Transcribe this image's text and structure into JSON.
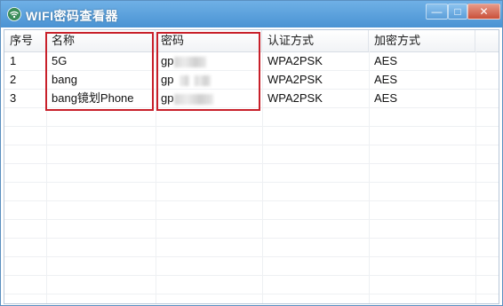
{
  "window": {
    "title": "WIFI密码查看器",
    "buttons": {
      "minimize": "—",
      "maximize": "□",
      "close": "✕"
    }
  },
  "table": {
    "columns": [
      "序号",
      "名称",
      "密码",
      "认证方式",
      "加密方式"
    ],
    "rows": [
      {
        "index": "1",
        "name": "5G",
        "password_visible": "gp",
        "auth": "WPA2PSK",
        "cipher": "AES"
      },
      {
        "index": "2",
        "name": "bang",
        "password_visible": "gp",
        "auth": "WPA2PSK",
        "cipher": "AES"
      },
      {
        "index": "3",
        "name": "bang镜划Phone",
        "password_visible": "gp",
        "auth": "WPA2PSK",
        "cipher": "AES"
      }
    ]
  },
  "colors": {
    "title_bar": "#4a93d3",
    "highlight_box": "#c8202a",
    "close_button": "#c9503a"
  },
  "icons": {
    "app": "wifi-icon"
  }
}
